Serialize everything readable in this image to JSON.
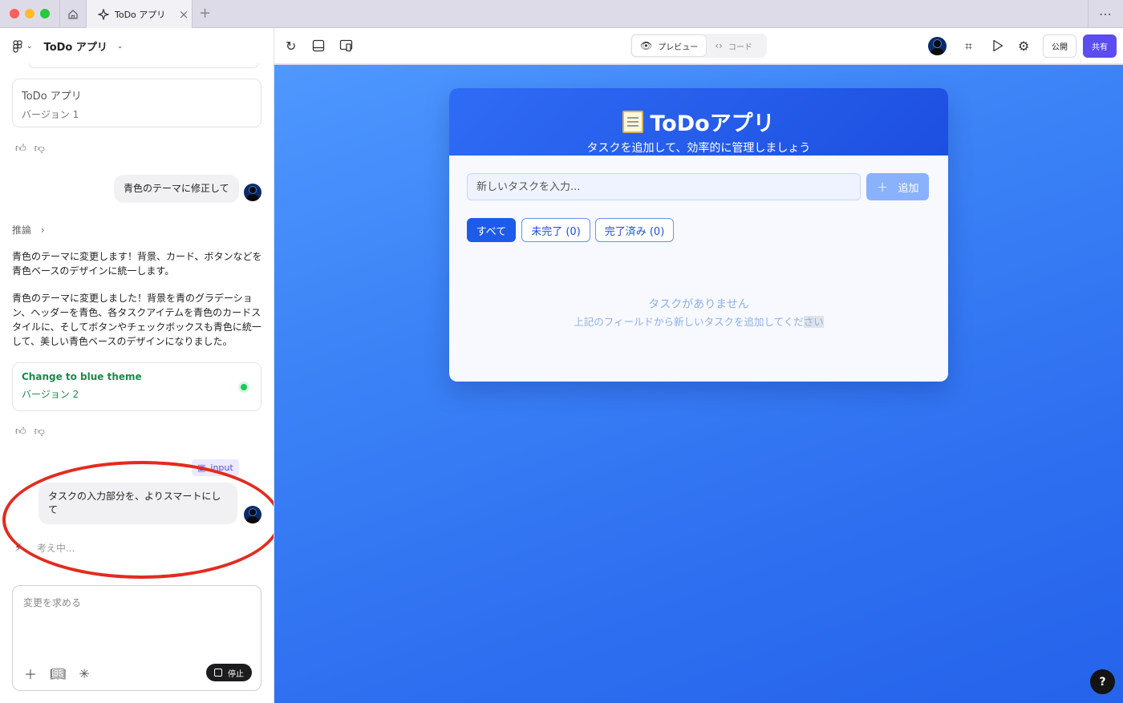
{
  "window": {
    "tab_title": "ToDo アプリ",
    "tab_close": "×",
    "new_tab": "+",
    "more": "⋯"
  },
  "sidebar": {
    "project_title": "ToDo アプリ",
    "cards": [
      {
        "title": "ToDo アプリ",
        "version": "バージョン 1"
      },
      {
        "title": "Change to blue theme",
        "version": "バージョン 2"
      }
    ],
    "messages": [
      {
        "role": "user",
        "text": "青色のテーマに修正して"
      },
      {
        "role": "user",
        "text": "タスクの入力部分を、よりスマートにして",
        "chip": "input"
      }
    ],
    "reasoning_label": "推論",
    "assistant_paragraphs": [
      "青色のテーマに変更します！背景、カード、ボタンなどを青色ベースのデザインに統一します。",
      "青色のテーマに変更しました！背景を青のグラデーション、ヘッダーを青色、各タスクアイテムを青色のカードスタイルに、そしてボタンやチェックボックスも青色に統一して、美しい青色ベースのデザインになりました。"
    ],
    "thinking": "考え中...",
    "composer_placeholder": "変更を求める",
    "stop_label": "停止"
  },
  "toolbar": {
    "preview_label": "プレビュー",
    "code_label": "コード",
    "publish_label": "公開",
    "share_label": "共有"
  },
  "app": {
    "title": "ToDoアプリ",
    "subtitle": "タスクを追加して、効率的に管理しましょう",
    "input_placeholder": "新しいタスクを入力...",
    "add_label": "追加",
    "filters": [
      "すべて",
      "未完了 (0)",
      "完了済み (0)"
    ],
    "empty_title": "タスクがありません",
    "empty_sub_main": "上記のフィールドから新しいタスクを追加してくだ",
    "empty_sub_highlight": "さい"
  },
  "help_label": "?",
  "colors": {
    "accent": "#5b4df0",
    "preview_bg": "#3b82f6",
    "app_header": "#1d4fe0",
    "annotation": "#e32b1f",
    "version_green": "#1a8a4a"
  }
}
